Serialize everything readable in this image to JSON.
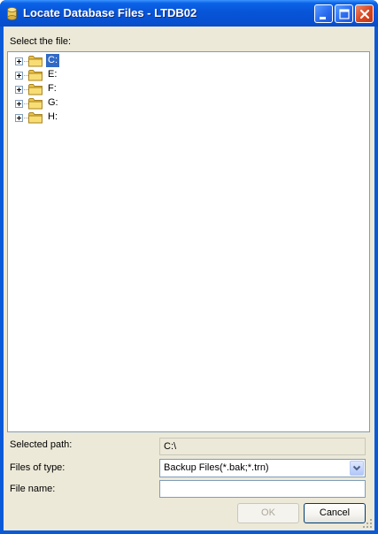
{
  "window": {
    "title": "Locate Database Files - LTDB02"
  },
  "tree": {
    "label": "Select the file:",
    "items": [
      {
        "label": "C:",
        "selected": true
      },
      {
        "label": "E:",
        "selected": false
      },
      {
        "label": "F:",
        "selected": false
      },
      {
        "label": "G:",
        "selected": false
      },
      {
        "label": "H:",
        "selected": false
      }
    ]
  },
  "fields": {
    "selected_path_label": "Selected path:",
    "selected_path_value": "C:\\",
    "files_of_type_label": "Files of type:",
    "files_of_type_value": "Backup Files(*.bak;*.trn)",
    "file_name_label": "File name:",
    "file_name_value": ""
  },
  "buttons": {
    "ok": "OK",
    "cancel": "Cancel"
  },
  "icons": {
    "title": "database-icon",
    "folder": "folder-icon",
    "expand": "plus-icon",
    "dropdown": "chevron-down-icon"
  },
  "colors": {
    "titlebar": "#0a5ad8",
    "selection": "#316ac5",
    "dialog_bg": "#ece9d8",
    "close_button": "#d8461f"
  }
}
